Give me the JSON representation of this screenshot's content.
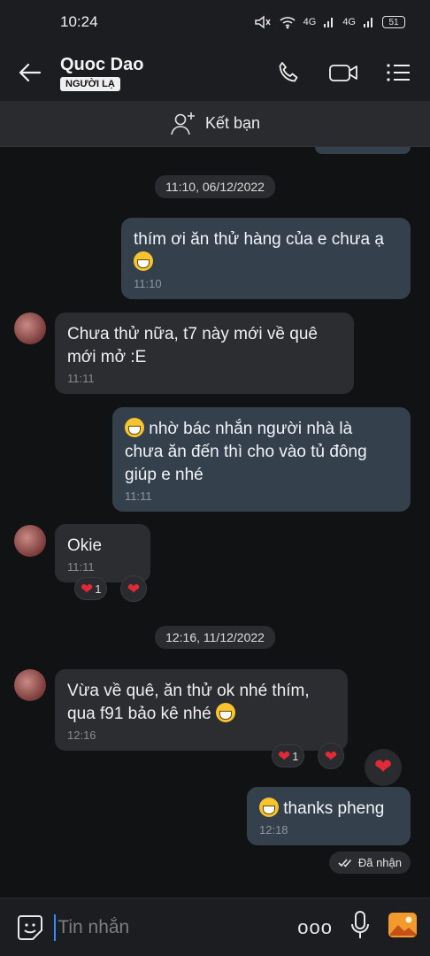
{
  "status": {
    "time": "10:24",
    "network1": "4G",
    "network2": "4G",
    "battery": "51"
  },
  "header": {
    "name": "Quoc Dao",
    "badge": "NGƯỜI LẠ"
  },
  "add_friend": {
    "label": "Kết bạn"
  },
  "messages": {
    "ts1": "11:10, 06/12/2022",
    "m1": {
      "text": "thím ơi ăn thử hàng của e chưa ạ",
      "time": "11:10"
    },
    "m2": {
      "line1": "Chưa thử nữa, t7 này mới về quê",
      "line2": "mới mở :E",
      "time": "11:11"
    },
    "m3": {
      "line1": "nhờ bác nhắn người nhà là",
      "line2": "chưa ăn đến thì cho vào tủ đông",
      "line3": "giúp e nhé",
      "time": "11:11"
    },
    "m4": {
      "text": "Okie",
      "time": "11:11",
      "reaction_count": "1"
    },
    "ts2": "12:16, 11/12/2022",
    "m5": {
      "line1": "Vừa về quê, ăn thử ok nhé thím,",
      "line2": "qua f91 bảo kê nhé",
      "time": "12:16",
      "reaction_count": "1"
    },
    "m6": {
      "text": "thanks pheng",
      "time": "12:18"
    },
    "delivered": "Đã nhận"
  },
  "input": {
    "placeholder": "Tin nhắn",
    "more": "ooo"
  },
  "colors": {
    "outgoing": "#35404d",
    "incoming": "#2c2d30",
    "heart": "#e02a36",
    "accent": "#2f8cff"
  }
}
